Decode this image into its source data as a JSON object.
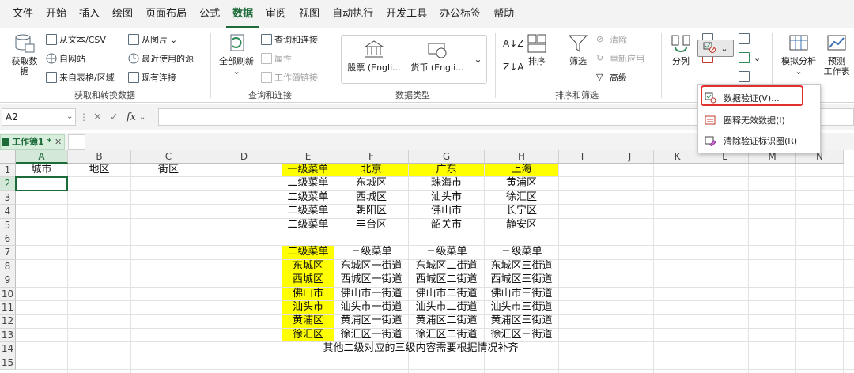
{
  "menu": [
    "文件",
    "开始",
    "插入",
    "绘图",
    "页面布局",
    "公式",
    "数据",
    "审阅",
    "视图",
    "自动执行",
    "开发工具",
    "办公标签",
    "帮助"
  ],
  "menu_active_index": 6,
  "ribbon": {
    "get_data": {
      "big_label_1": "获取数",
      "big_label_2": "据",
      "from_text_csv": "从文本/CSV",
      "from_web": "自网站",
      "from_table": "来自表格/区域",
      "from_picture": "从图片",
      "recent_sources": "最近使用的源",
      "existing_conn": "现有连接",
      "group": "获取和转换数据"
    },
    "queries": {
      "refresh_all": "全部刷新",
      "queries_conn": "查询和连接",
      "properties": "属性",
      "edit_links": "工作簿链接",
      "group": "查询和连接"
    },
    "datatypes": {
      "stocks": "股票 (Engli...",
      "currency": "货币 (Engli...",
      "group": "数据类型"
    },
    "sort_filter": {
      "sort": "排序",
      "filter": "筛选",
      "clear": "清除",
      "reapply": "重新应用",
      "advanced": "高级",
      "group": "排序和筛选"
    },
    "tools": {
      "split": "分列"
    },
    "forecast": {
      "whatif": "模拟分析",
      "forecast_1": "预测",
      "forecast_2": "工作表"
    }
  },
  "namebox": "A2",
  "fx": "fx",
  "workbook_tab": "工作簿1 *",
  "columns": [
    "A",
    "B",
    "C",
    "D",
    "E",
    "F",
    "G",
    "H",
    "I",
    "J",
    "K",
    "L",
    "M",
    "N"
  ],
  "rows": [
    "1",
    "2",
    "3",
    "4",
    "5",
    "6",
    "7",
    "8",
    "9",
    "10",
    "11",
    "12",
    "13",
    "14",
    "15"
  ],
  "cells": {
    "A1": "城市",
    "B1": "地区",
    "C1": "街区",
    "E1": "一级菜单",
    "F1": "北京",
    "G1": "广东",
    "H1": "上海",
    "E2": "二级菜单",
    "F2": "东城区",
    "G2": "珠海市",
    "H2": "黄浦区",
    "E3": "二级菜单",
    "F3": "西城区",
    "G3": "汕头市",
    "H3": "徐汇区",
    "E4": "二级菜单",
    "F4": "朝阳区",
    "G4": "佛山市",
    "H4": "长宁区",
    "E5": "二级菜单",
    "F5": "丰台区",
    "G5": "韶关市",
    "H5": "静安区",
    "E7": "二级菜单",
    "F7": "三级菜单",
    "G7": "三级菜单",
    "H7": "三级菜单",
    "E8": "东城区",
    "F8": "东城区一街道",
    "G8": "东城区二街道",
    "H8": "东城区三街道",
    "E9": "西城区",
    "F9": "西城区一街道",
    "G9": "西城区二街道",
    "H9": "西城区三街道",
    "E10": "佛山市",
    "F10": "佛山市一街道",
    "G10": "佛山市二街道",
    "H10": "佛山市三街道",
    "E11": "汕头市",
    "F11": "汕头市一街道",
    "G11": "汕头市二街道",
    "H11": "汕头市三街道",
    "E12": "黄浦区",
    "F12": "黄浦区一街道",
    "G12": "黄浦区二街道",
    "H12": "黄浦区三街道",
    "E13": "徐汇区",
    "F13": "徐汇区一街道",
    "G13": "徐汇区二街道",
    "H13": "徐汇区三街道",
    "E14": "其他二级对应的三级内容需要根据情况补齐"
  },
  "highlight_cells": [
    "E1",
    "F1",
    "G1",
    "H1",
    "E7",
    "E8",
    "E9",
    "E10",
    "E11",
    "E12",
    "E13"
  ],
  "selected_cell": "A2",
  "dv_menu": {
    "items": [
      "数据验证(V)...",
      "圈释无效数据(I)",
      "清除验证标识圈(R)"
    ]
  },
  "colors": {
    "accent": "#1e6b3a",
    "highlight": "#ffff00",
    "callout": "#e03030"
  }
}
